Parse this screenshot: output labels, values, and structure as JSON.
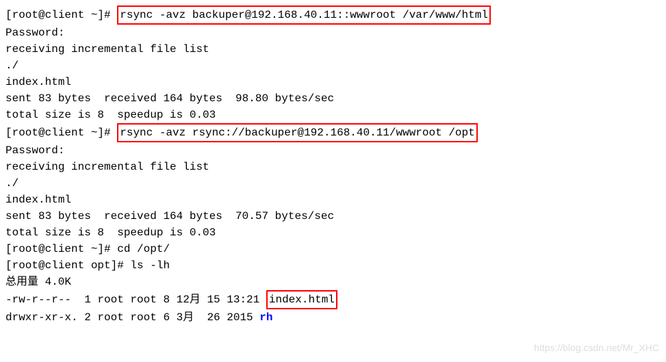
{
  "lines": {
    "l1_prompt": "[root@client ~]# ",
    "l1_cmd": "rsync -avz backuper@192.168.40.11::wwwroot /var/www/html",
    "l2": "Password:",
    "l3": "receiving incremental file list",
    "l4": "./",
    "l5": "index.html",
    "l6": "",
    "l7": "sent 83 bytes  received 164 bytes  98.80 bytes/sec",
    "l8": "total size is 8  speedup is 0.03",
    "l9_prompt": "[root@client ~]# ",
    "l9_cmd": "rsync -avz rsync://backuper@192.168.40.11/wwwroot /opt",
    "l10": "Password:",
    "l11": "receiving incremental file list",
    "l12": "./",
    "l13": "index.html",
    "l14": "",
    "l15": "sent 83 bytes  received 164 bytes  70.57 bytes/sec",
    "l16": "total size is 8  speedup is 0.03",
    "l17": "[root@client ~]# cd /opt/",
    "l18": "[root@client opt]# ls -lh",
    "l19": "总用量 4.0K",
    "l20_pre": "-rw-r--r--  1 root root 8 12月 15 13:21 ",
    "l20_file": "index.html",
    "l21_pre": "drwxr-xr-x. 2 root root 6 3月  26 2015 ",
    "l21_dir": "rh"
  },
  "watermark": "https://blog.csdn.net/Mr_XHC"
}
